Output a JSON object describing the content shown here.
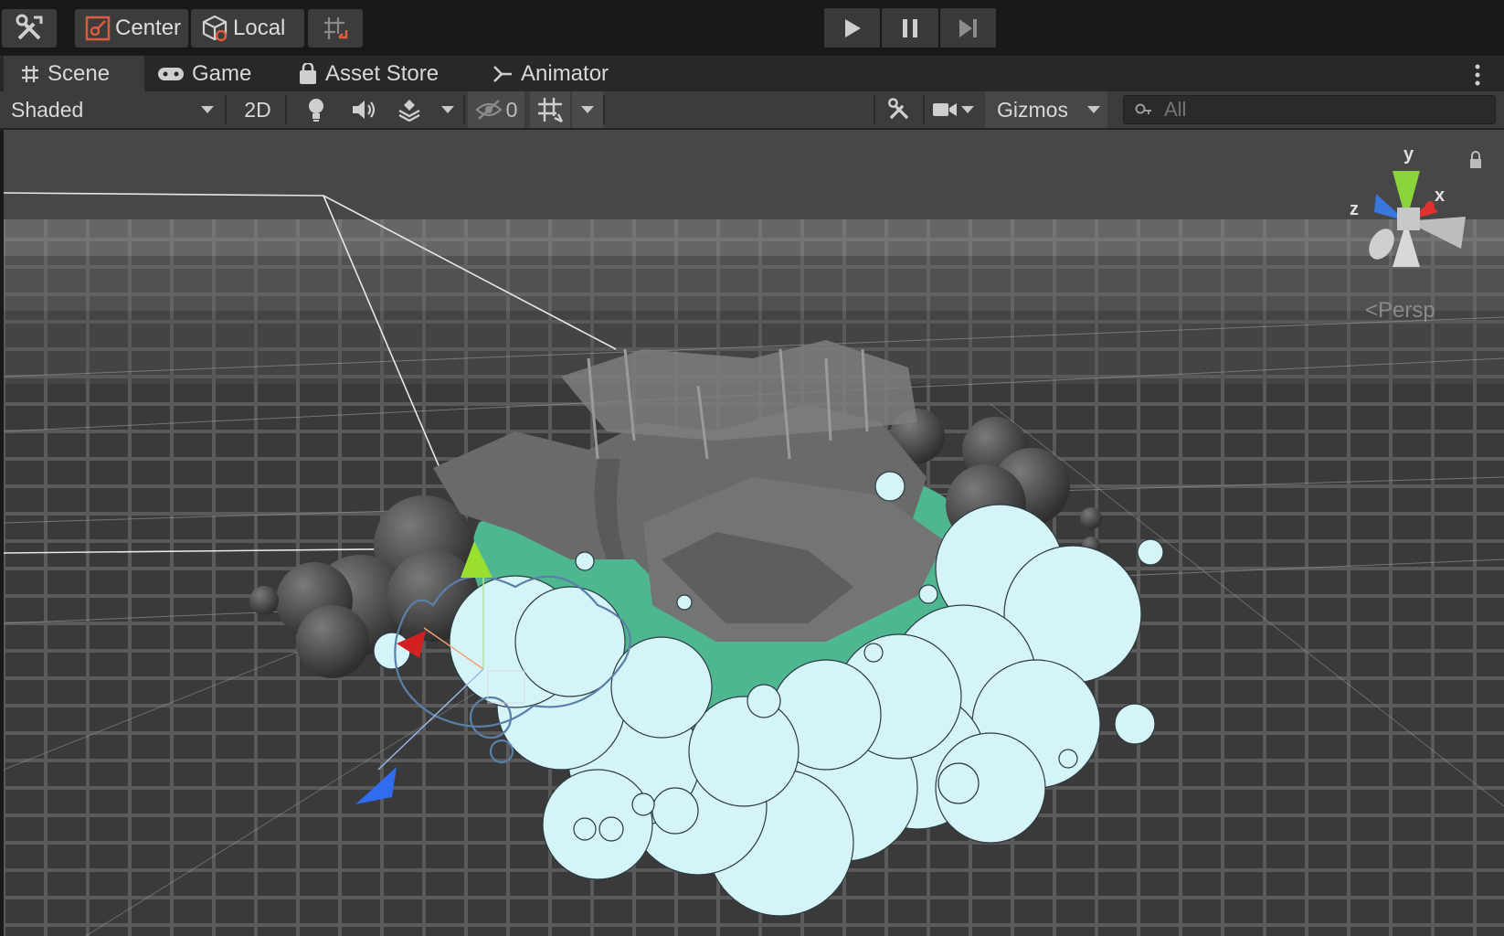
{
  "toolbar": {
    "pivot_label": "Center",
    "space_label": "Local",
    "tool_icon": "tools-icon",
    "snap_icon": "grid-snap-icon"
  },
  "tabs": [
    {
      "label": "Scene",
      "icon": "hash-icon",
      "active": true
    },
    {
      "label": "Game",
      "icon": "gamepad-icon",
      "active": false
    },
    {
      "label": "Asset Store",
      "icon": "bag-icon",
      "active": false
    },
    {
      "label": "Animator",
      "icon": "animator-icon",
      "active": false
    }
  ],
  "scenebar": {
    "shading_mode": "Shaded",
    "mode_2d": "2D",
    "hidden_count": "0",
    "gizmos_label": "Gizmos",
    "search_placeholder": "All"
  },
  "viewport": {
    "projection_label": "Persp",
    "axis_labels": {
      "y": "y",
      "x": "x",
      "z": "z"
    }
  },
  "colors": {
    "ground_grid": "#5a5a5a",
    "terrain_green": "#4fb78f",
    "cloud": "#d4f4f7",
    "gizmo_green": "#9be02f",
    "gizmo_red": "#d32020",
    "gizmo_blue": "#2f6cf0"
  }
}
